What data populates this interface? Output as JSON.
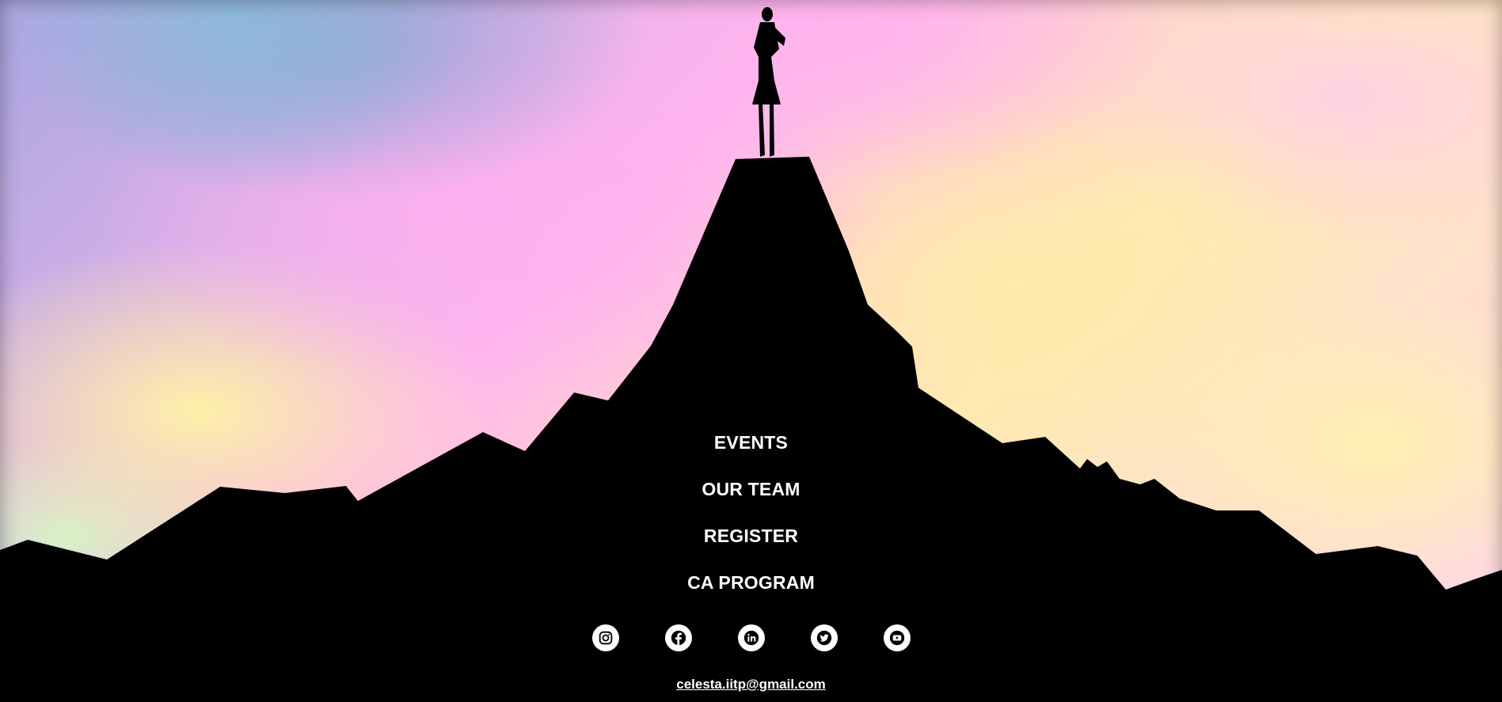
{
  "nav": {
    "items": [
      {
        "label": "EVENTS"
      },
      {
        "label": "OUR TEAM"
      },
      {
        "label": "REGISTER"
      },
      {
        "label": "CA PROGRAM"
      }
    ]
  },
  "socials": [
    {
      "icon": "instagram-icon"
    },
    {
      "icon": "facebook-icon"
    },
    {
      "icon": "linkedin-icon"
    },
    {
      "icon": "twitter-icon"
    },
    {
      "icon": "youtube-icon"
    }
  ],
  "contact": {
    "email": "celesta.iitp@gmail.com"
  },
  "colors": {
    "silhouette": "#000000",
    "text": "#ffffff",
    "sky_pink": "#ffb7ed",
    "sky_yellow": "#ffe9b4",
    "sky_blue": "#a8a6e0"
  }
}
